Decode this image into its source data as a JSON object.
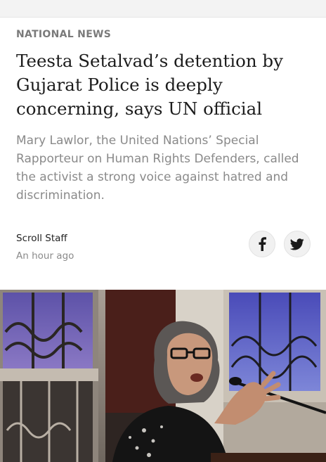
{
  "article": {
    "category": "NATIONAL NEWS",
    "headline": "Teesta Setalvad’s detention by Gujarat Police is deeply concerning, says UN official",
    "summary": "Mary Lawlor, the United Nations’ Special Rapporteur on Human Rights Defenders, called the activist a strong voice against hatred and discrimination.",
    "author": "Scroll Staff",
    "timestamp": "An hour ago"
  },
  "share": {
    "facebook_icon": "facebook-icon",
    "twitter_icon": "twitter-icon"
  },
  "colors": {
    "category": "#7a7a7a",
    "headline": "#1c1c1c",
    "summary": "#8a8a8a",
    "share_button_bg": "#f1f1f1"
  }
}
